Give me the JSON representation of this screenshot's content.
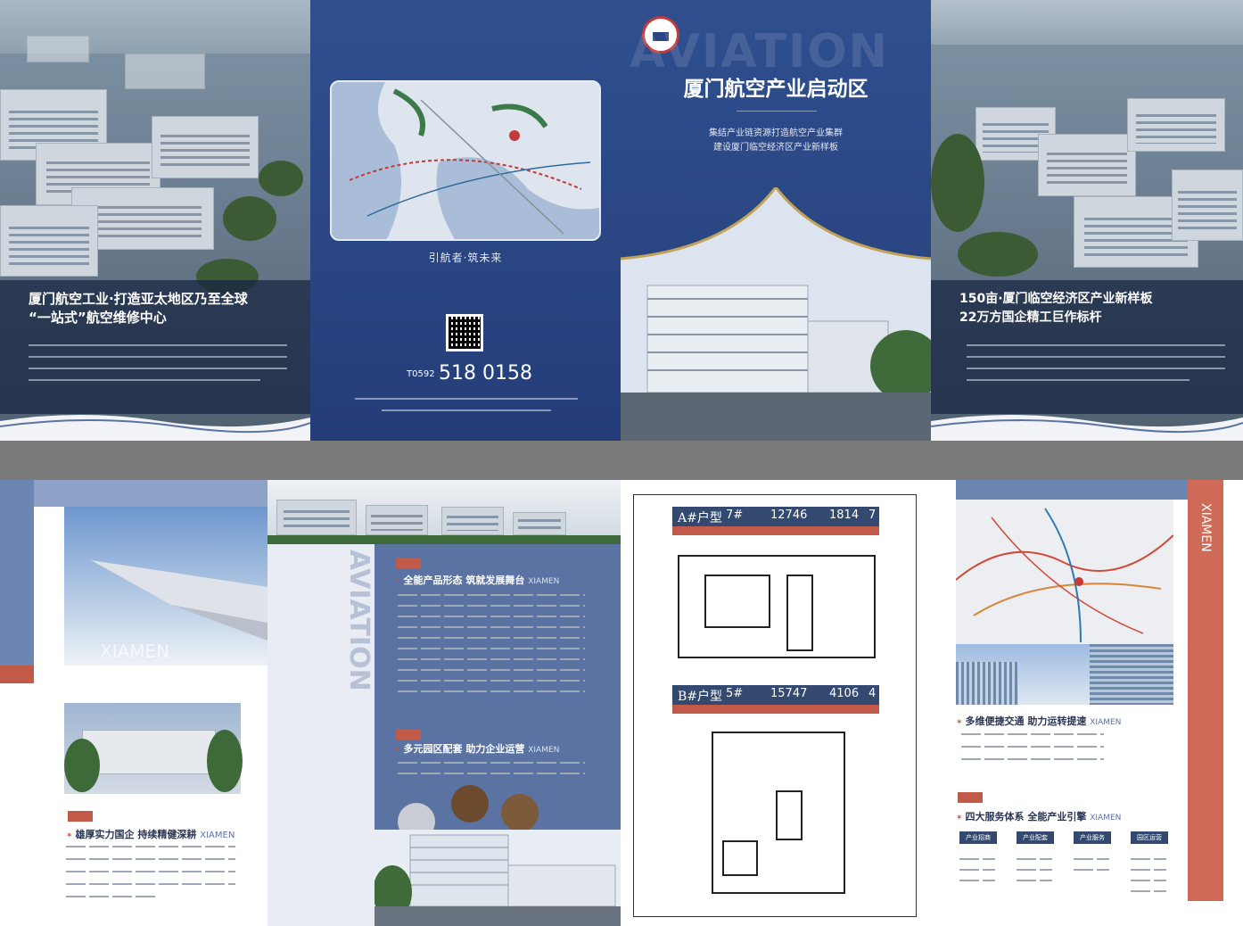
{
  "panel1": {
    "heading_line1": "厦门航空工业·打造亚太地区乃至全球",
    "heading_line2": "“一站式”航空维修中心"
  },
  "panel2": {
    "slogan": "引航者·筑未来",
    "phone_prefix": "T0592",
    "phone_number": "518 0158"
  },
  "panel3": {
    "watermark": "AVIATION",
    "title": "厦门航空产业启动区",
    "tagline1": "集结产业链资源打造航空产业集群",
    "tagline2": "建设厦门临空经济区产业新样板"
  },
  "panel4": {
    "heading_line1": "150亩·厦门临空经济区产业新样板",
    "heading_line2": "22万方国企精工巨作标杆"
  },
  "panel5": {
    "xiamen_watermark": "XIAMEN",
    "section_heading": "雄厚实力国企 持续精健深耕",
    "section_brand": "XIAMEN"
  },
  "panel6": {
    "vertical_watermark": "AVIATION",
    "heading1": "全能产品形态 筑就发展舞台",
    "heading1_brand": "XIAMEN",
    "heading2": "多元园区配套 助力企业运营",
    "heading2_brand": "XIAMEN"
  },
  "panel7": {
    "planA_title": "A#户型",
    "planA_sub": "7#",
    "planA_area1": "12746",
    "planA_area2": "1814",
    "planA_end": "7",
    "planB_title": "B#户型",
    "planB_sub": "5#",
    "planB_area1": "15747",
    "planB_area2": "4106",
    "planB_end": "4"
  },
  "panel8": {
    "vertical_brand": "XIAMEN",
    "heading1": "多维便捷交通 助力运转提速",
    "heading1_brand": "XIAMEN",
    "heading2": "四大服务体系 全能产业引擎",
    "heading2_brand": "XIAMEN",
    "services": [
      "产业招商",
      "产业配套",
      "产业服务",
      "园区运营"
    ]
  },
  "colors": {
    "navy": "#2a4683",
    "accent_red": "#c25a4a",
    "steel_blue": "#5a73a3"
  }
}
